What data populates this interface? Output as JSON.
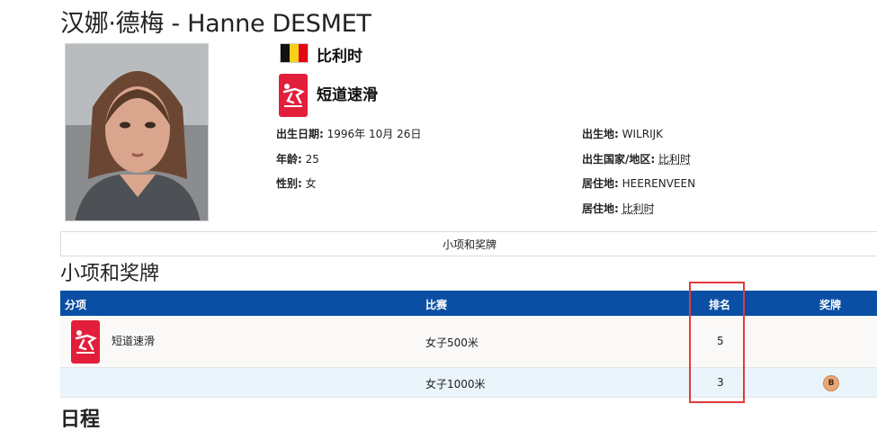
{
  "athlete": {
    "name_title": "汉娜·德梅 - Hanne DESMET",
    "country": "比利时",
    "sport": "短道速滑"
  },
  "details_left": [
    {
      "label": "出生日期:",
      "value": "1996年 10月 26日"
    },
    {
      "label": "年龄:",
      "value": "25"
    },
    {
      "label": "性别:",
      "value": "女"
    }
  ],
  "details_right": [
    {
      "label": "出生地:",
      "value": "WILRIJK"
    },
    {
      "label": "出生国家/地区:",
      "value": "比利时"
    },
    {
      "label": "居住地:",
      "value": "HEERENVEEN"
    },
    {
      "label": "居住地:",
      "value": "比利时"
    }
  ],
  "tab": {
    "label": "小项和奖牌"
  },
  "events_section": {
    "title": "小项和奖牌",
    "headers": {
      "discipline": "分项",
      "event": "比赛",
      "rank": "排名",
      "medal": "奖牌"
    },
    "rows": [
      {
        "discipline": "短道速滑",
        "event": "女子500米",
        "rank": "5",
        "medal": ""
      },
      {
        "discipline": "",
        "event": "女子1000米",
        "rank": "3",
        "medal": "B"
      }
    ]
  },
  "next_section": {
    "title": "日程"
  },
  "colors": {
    "header_blue": "#0a4fa3",
    "sport_red": "#e21e3a",
    "highlight": "#e23b3b",
    "bronze": "#e8a777"
  },
  "icons": {
    "flag": "belgium-flag-icon",
    "sport": "short-track-speed-skating-icon",
    "medal": "bronze-medal-icon"
  }
}
